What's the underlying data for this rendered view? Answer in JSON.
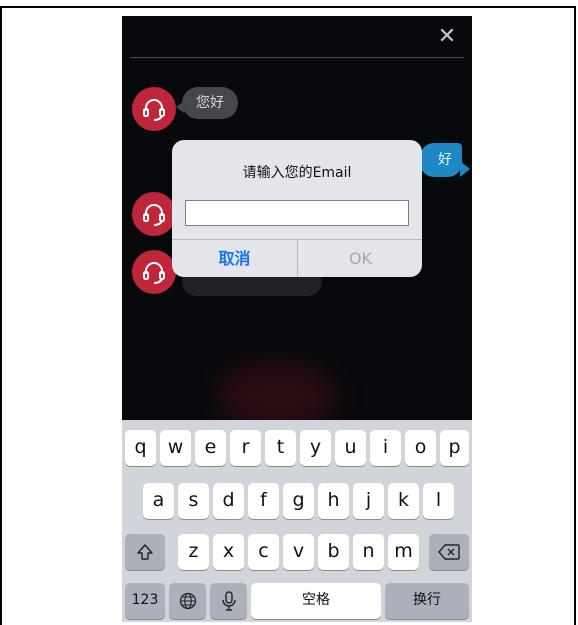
{
  "chat": {
    "close_symbol": "✕",
    "incoming_greeting": "您好",
    "outgoing_partial": "好"
  },
  "dialog": {
    "title": "请输入您的Email",
    "input_value": "",
    "input_placeholder": "",
    "cancel_label": "取消",
    "ok_label": "OK"
  },
  "keyboard": {
    "row1": [
      "q",
      "w",
      "e",
      "r",
      "t",
      "y",
      "u",
      "i",
      "o",
      "p"
    ],
    "row2": [
      "a",
      "s",
      "d",
      "f",
      "g",
      "h",
      "j",
      "k",
      "l"
    ],
    "row3": [
      "z",
      "x",
      "c",
      "v",
      "b",
      "n",
      "m"
    ],
    "numbers_label": "123",
    "space_label": "空格",
    "return_label": "换行"
  },
  "colors": {
    "avatar": "#c0263a",
    "outgoing_bubble": "#1e88c4",
    "dialog_button": "#1877e6"
  }
}
